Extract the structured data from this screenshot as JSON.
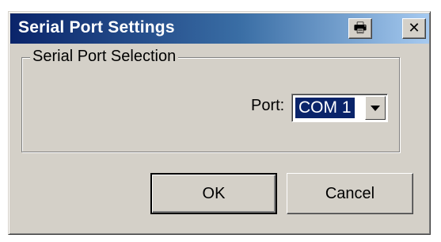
{
  "window": {
    "title": "Serial Port Settings",
    "title_buttons": [
      {
        "name": "printer-icon",
        "glyph": "🖶"
      },
      {
        "name": "close-icon",
        "glyph": "✕"
      }
    ],
    "colors": {
      "face": "#d4d0c8",
      "title_start": "#0a246a",
      "title_end": "#a6caf0",
      "selection": "#0a246a"
    }
  },
  "group": {
    "legend": "Serial Port Selection",
    "port_label": "Port:",
    "port_value": "COM 1"
  },
  "buttons": {
    "ok_label": "OK",
    "cancel_label": "Cancel"
  }
}
